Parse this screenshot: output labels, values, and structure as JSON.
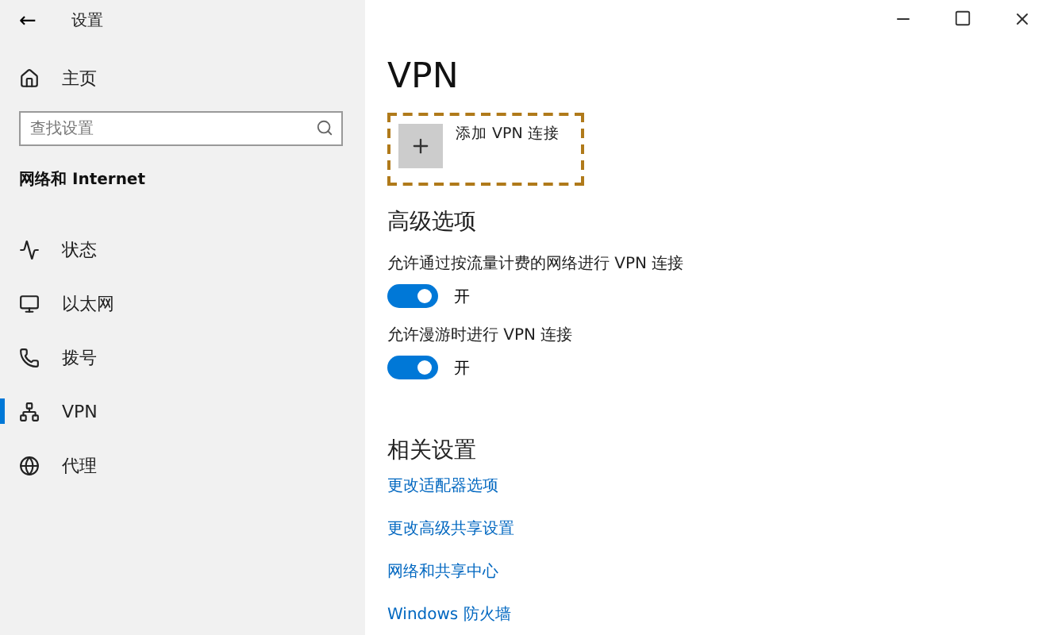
{
  "window": {
    "title": "设置",
    "back": "←"
  },
  "sidebar": {
    "home": "主页",
    "search": {
      "placeholder": "查找设置"
    },
    "section": "网络和 Internet",
    "items": [
      {
        "label": "状态",
        "selected": false
      },
      {
        "label": "以太网",
        "selected": false
      },
      {
        "label": "拨号",
        "selected": false
      },
      {
        "label": "VPN",
        "selected": true
      },
      {
        "label": "代理",
        "selected": false
      }
    ]
  },
  "main": {
    "title": "VPN",
    "add_button": {
      "label": "添加 VPN 连接",
      "highlighted": true
    },
    "advanced": {
      "heading": "高级选项",
      "options": [
        {
          "label": "允许通过按流量计费的网络进行 VPN 连接",
          "on": true,
          "state": "开"
        },
        {
          "label": "允许漫游时进行 VPN 连接",
          "on": true,
          "state": "开"
        }
      ]
    },
    "related": {
      "heading": "相关设置",
      "links": [
        "更改适配器选项",
        "更改高级共享设置",
        "网络和共享中心",
        "Windows 防火墙"
      ]
    }
  }
}
